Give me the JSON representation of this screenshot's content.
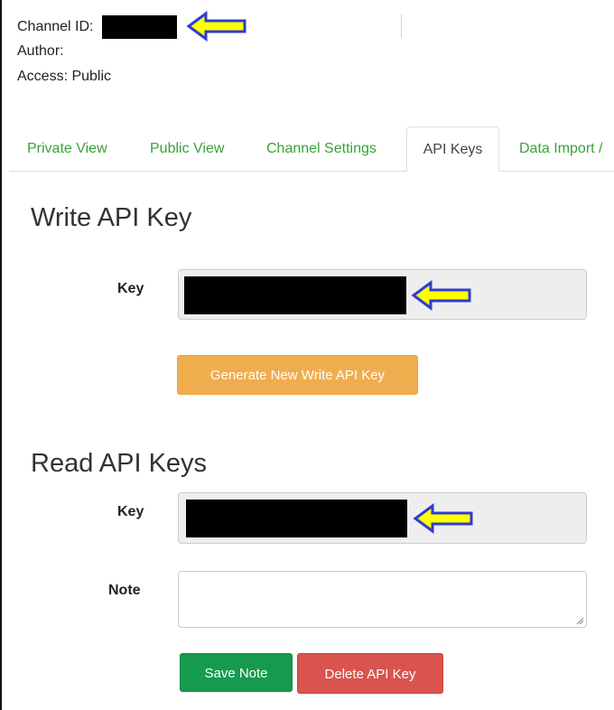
{
  "channel_info": {
    "channel_id_label": "Channel ID:",
    "author_label": "Author:",
    "access_label": "Access: Public"
  },
  "tabs": [
    {
      "label": "Private View",
      "active": false
    },
    {
      "label": "Public View",
      "active": false
    },
    {
      "label": "Channel Settings",
      "active": false
    },
    {
      "label": "API Keys",
      "active": true
    },
    {
      "label": "Data Import /",
      "active": false
    }
  ],
  "write_section": {
    "title": "Write API Key",
    "key_label": "Key",
    "generate_button": "Generate New Write API Key"
  },
  "read_section": {
    "title": "Read API Keys",
    "key_label": "Key",
    "note_label": "Note",
    "note_value": "",
    "save_button": "Save Note",
    "delete_button": "Delete API Key"
  },
  "colors": {
    "tab_link": "#36a336",
    "orange_button": "#f0ad4e",
    "green_button": "#159a4f",
    "red_button": "#d9534f",
    "arrow_fill": "#ffff00",
    "arrow_outline": "#2f3bd4"
  },
  "icons": {
    "annotation_arrow": "left-arrow-icon",
    "resize_handle": "resize-grip-icon"
  }
}
